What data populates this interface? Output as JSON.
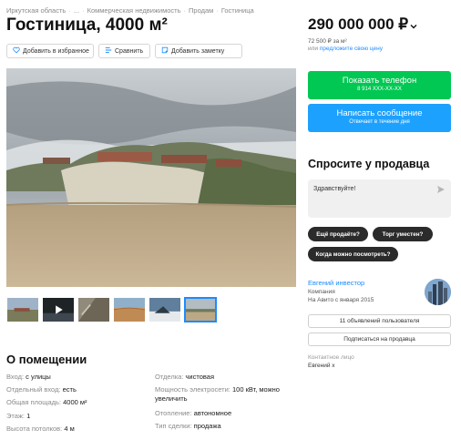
{
  "breadcrumb": [
    "Иркутская область",
    "...",
    "Коммерческая недвижимость",
    "Продам",
    "Гостиница"
  ],
  "title": "Гостиница, 4000 м²",
  "actions": {
    "favorite": "Добавить в избранное",
    "compare": "Сравнить",
    "note": "Добавить заметку"
  },
  "gallery": {
    "thumb_count": 6,
    "active_thumb": 6
  },
  "about": {
    "title": "О помещении",
    "left": [
      {
        "key": "Вход:",
        "value": "с улицы"
      },
      {
        "key": "Отдельный вход:",
        "value": "есть"
      },
      {
        "key": "Общая площадь:",
        "value": "4000 м²"
      },
      {
        "key": "Этаж:",
        "value": "1"
      },
      {
        "key": "Высота потолков:",
        "value": "4 м"
      }
    ],
    "right": [
      {
        "key": "Отделка:",
        "value": "чистовая"
      },
      {
        "key": "Мощность электросети:",
        "value": "100 кВт, можно",
        "value2": "увеличить"
      },
      {
        "key": "Отопление:",
        "value": "автономное"
      },
      {
        "key": "Тип сделки:",
        "value": "продажа"
      }
    ]
  },
  "price": {
    "value": "290 000 000 ₽",
    "per_m2": "72 500 ₽ за м²",
    "or": "или",
    "offer_link": "предложите свою цену"
  },
  "phone_button": {
    "label": "Показать телефон",
    "sub": "8 914 XXX-XX-XX"
  },
  "message_button": {
    "label": "Написать сообщение",
    "sub": "Отвечает в течение дня"
  },
  "ask": {
    "title": "Спросите у продавца",
    "text": "Здравствуйте!",
    "chips": [
      "Ещё продаёте?",
      "Торг уместен?",
      "Когда можно посмотреть?"
    ]
  },
  "seller": {
    "name": "Евгений инвестор",
    "type": "Компания",
    "since": "На Авито с января 2015",
    "listings_button": "11 объявлений пользователя",
    "subscribe_button": "Подписаться на продавца",
    "contact_label": "Контактное лицо",
    "contact_name": "Евгений х"
  },
  "colors": {
    "phone_green": "#00c853",
    "message_blue": "#1da1ff",
    "link_blue": "#1d8bff"
  }
}
